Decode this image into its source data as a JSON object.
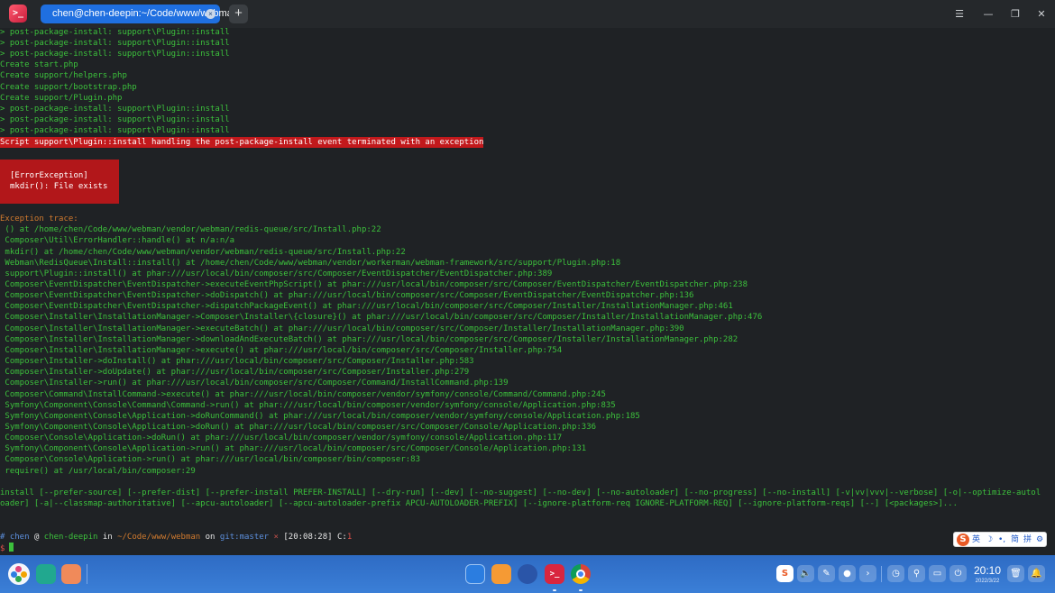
{
  "window": {
    "tab_title": "chen@chen-deepin:~/Code/www/webman",
    "tab_close_glyph": "×",
    "new_tab_glyph": "+",
    "menu_glyph": "☰",
    "min_glyph": "—",
    "max_glyph": "❐",
    "close_glyph": "✕",
    "app_logo_glyph": ">_"
  },
  "terminal": {
    "lines": [
      "> post-package-install: support\\Plugin::install",
      "> post-package-install: support\\Plugin::install",
      "> post-package-install: support\\Plugin::install",
      "Create start.php",
      "Create support/helpers.php",
      "Create support/bootstrap.php",
      "Create support/Plugin.php",
      "> post-package-install: support\\Plugin::install",
      "> post-package-install: support\\Plugin::install",
      "> post-package-install: support\\Plugin::install"
    ],
    "error_line": "Script support\\Plugin::install handling the post-package-install event terminated with an exception",
    "error_box": {
      "title": "[ErrorException]",
      "message": "mkdir(): File exists"
    },
    "trace_header": "Exception trace:",
    "trace": [
      " () at /home/chen/Code/www/webman/vendor/webman/redis-queue/src/Install.php:22",
      " Composer\\Util\\ErrorHandler::handle() at n/a:n/a",
      " mkdir() at /home/chen/Code/www/webman/vendor/webman/redis-queue/src/Install.php:22",
      " Webman\\RedisQueue\\Install::install() at /home/chen/Code/www/webman/vendor/workerman/webman-framework/src/support/Plugin.php:18",
      " support\\Plugin::install() at phar:///usr/local/bin/composer/src/Composer/EventDispatcher/EventDispatcher.php:389",
      " Composer\\EventDispatcher\\EventDispatcher->executeEventPhpScript() at phar:///usr/local/bin/composer/src/Composer/EventDispatcher/EventDispatcher.php:238",
      " Composer\\EventDispatcher\\EventDispatcher->doDispatch() at phar:///usr/local/bin/composer/src/Composer/EventDispatcher/EventDispatcher.php:136",
      " Composer\\EventDispatcher\\EventDispatcher->dispatchPackageEvent() at phar:///usr/local/bin/composer/src/Composer/Installer/InstallationManager.php:461",
      " Composer\\Installer\\InstallationManager->Composer\\Installer\\{closure}() at phar:///usr/local/bin/composer/src/Composer/Installer/InstallationManager.php:476",
      " Composer\\Installer\\InstallationManager->executeBatch() at phar:///usr/local/bin/composer/src/Composer/Installer/InstallationManager.php:390",
      " Composer\\Installer\\InstallationManager->downloadAndExecuteBatch() at phar:///usr/local/bin/composer/src/Composer/Installer/InstallationManager.php:282",
      " Composer\\Installer\\InstallationManager->execute() at phar:///usr/local/bin/composer/src/Composer/Installer.php:754",
      " Composer\\Installer->doInstall() at phar:///usr/local/bin/composer/src/Composer/Installer.php:583",
      " Composer\\Installer->doUpdate() at phar:///usr/local/bin/composer/src/Composer/Installer.php:279",
      " Composer\\Installer->run() at phar:///usr/local/bin/composer/src/Composer/Command/InstallCommand.php:139",
      " Composer\\Command\\InstallCommand->execute() at phar:///usr/local/bin/composer/vendor/symfony/console/Command/Command.php:245",
      " Symfony\\Component\\Console\\Command\\Command->run() at phar:///usr/local/bin/composer/vendor/symfony/console/Application.php:835",
      " Symfony\\Component\\Console\\Application->doRunCommand() at phar:///usr/local/bin/composer/vendor/symfony/console/Application.php:185",
      " Symfony\\Component\\Console\\Application->doRun() at phar:///usr/local/bin/composer/src/Composer/Console/Application.php:336",
      " Composer\\Console\\Application->doRun() at phar:///usr/local/bin/composer/vendor/symfony/console/Application.php:117",
      " Symfony\\Component\\Console\\Application->run() at phar:///usr/local/bin/composer/src/Composer/Console/Application.php:131",
      " Composer\\Console\\Application->run() at phar:///usr/local/bin/composer/bin/composer:83",
      " require() at /usr/local/bin/composer:29"
    ],
    "usage_line_1": "install [--prefer-source] [--prefer-dist] [--prefer-install PREFER-INSTALL] [--dry-run] [--dev] [--no-suggest] [--no-dev] [--no-autoloader] [--no-progress] [--no-install] [-v|vv|vvv|--verbose] [-o|--optimize-autol",
    "usage_line_2": "oader] [-a|--classmap-authoritative] [--apcu-autoloader] [--apcu-autoloader-prefix APCU-AUTOLOADER-PREFIX] [--ignore-platform-req IGNORE-PLATFORM-REQ] [--ignore-platform-reqs] [--] [<packages>]...",
    "prompt": {
      "hash": "#",
      "user": "chen",
      "at": "@",
      "host": "chen-deepin",
      "in": "in",
      "path": "~/Code/www/webman",
      "on": "on",
      "git_label": "git:",
      "branch": "master",
      "dirty": "×",
      "time": "[20:08:28]",
      "code_label": "C:",
      "code": "1",
      "dollar": "$"
    }
  },
  "ime": {
    "logo": "S",
    "items": [
      "英",
      "☽",
      "•,",
      "简",
      "拼",
      "⚙"
    ]
  },
  "taskbar": {
    "terminal_glyph": ">_",
    "tray_sogou": "S",
    "tray_volume": "🔈",
    "tray_pen": "✎",
    "tray_mouse": "●",
    "tray_more": "›",
    "tray_clock_app": "◷",
    "tray_search": "⚲",
    "tray_screen": "▭",
    "tray_power": "⏻",
    "tray_trash": "🗑",
    "tray_notify": "🔔",
    "time": "20:10",
    "date": "2022/3/22"
  },
  "colors": {
    "terminal_bg": "#1f2225",
    "text_green": "#3cc03c",
    "error_red": "#c2191c",
    "trace_orange": "#d07a2e",
    "tab_blue": "#1f6fe0",
    "taskbar_blue": "#3b7fd7"
  }
}
